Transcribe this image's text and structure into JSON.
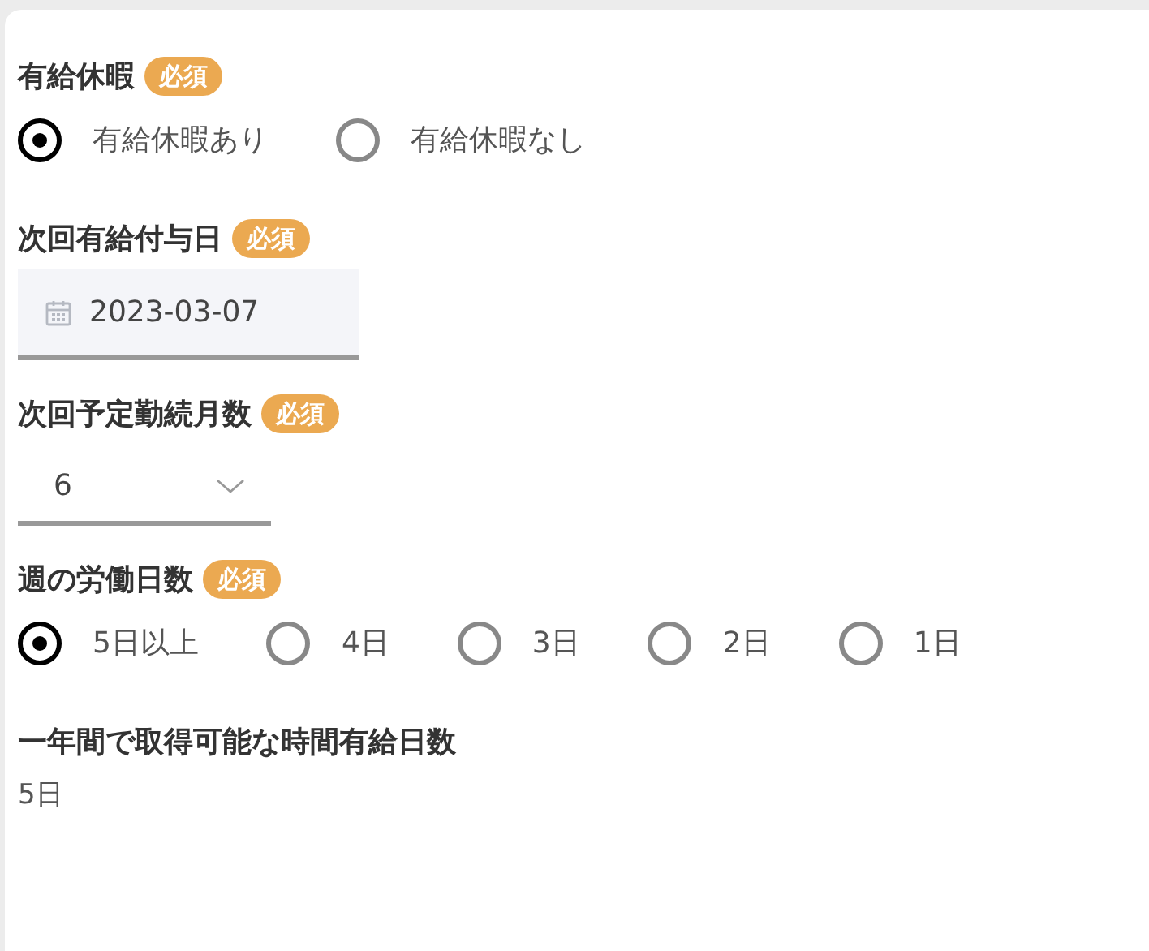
{
  "fields": [
    {
      "kind": "radio",
      "label": "有給休暇",
      "badge": "必須",
      "options": [
        {
          "label": "有給休暇あり",
          "selected": true
        },
        {
          "label": "有給休暇なし",
          "selected": false
        }
      ]
    },
    {
      "kind": "date",
      "label": "次回有給付与日",
      "badge": "必須",
      "value": "2023-03-07"
    },
    {
      "kind": "select",
      "label": "次回予定勤続月数",
      "badge": "必須",
      "value": "6"
    },
    {
      "kind": "radio",
      "label": "週の労働日数",
      "badge": "必須",
      "options": [
        {
          "label": "5日以上",
          "selected": true
        },
        {
          "label": "4日",
          "selected": false
        },
        {
          "label": "3日",
          "selected": false
        },
        {
          "label": "2日",
          "selected": false
        },
        {
          "label": "1日",
          "selected": false
        }
      ]
    },
    {
      "kind": "text",
      "label": "一年間で取得可能な時間有給日数",
      "value": "5日"
    }
  ]
}
